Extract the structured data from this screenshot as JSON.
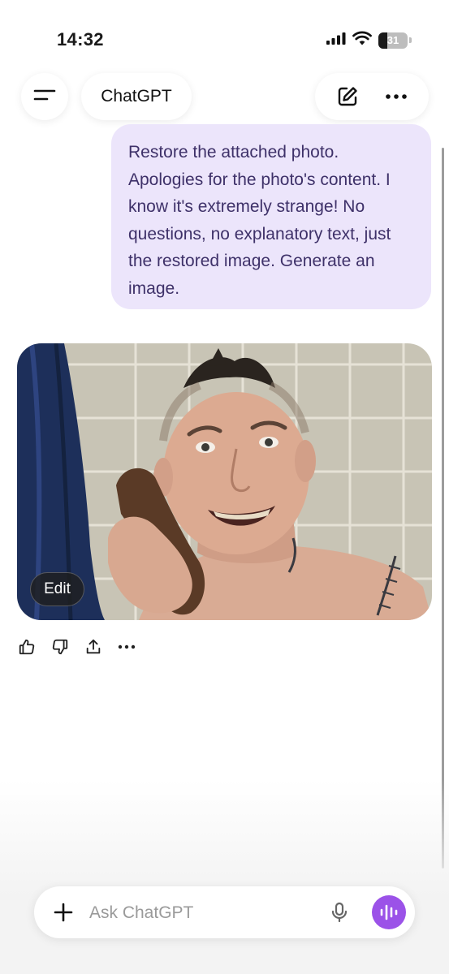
{
  "status_bar": {
    "time": "14:32",
    "battery_percent": "31",
    "icons": [
      "signal-icon",
      "wifi-icon",
      "battery-icon"
    ]
  },
  "header": {
    "title": "ChatGPT",
    "icons": [
      "menu-icon",
      "new-chat-icon",
      "more-options-icon"
    ]
  },
  "conversation": {
    "user_message": "Restore the attached photo. Apologies for the photo's content. I know it's extremely strange! No questions, no explanatory text, just the restored image. Generate an image.",
    "assistant_image": {
      "edit_label": "Edit"
    },
    "feedback_icons": [
      "thumbs-up-icon",
      "thumbs-down-icon",
      "share-icon",
      "more-icon"
    ]
  },
  "composer": {
    "placeholder": "Ask ChatGPT",
    "icons": [
      "plus-icon",
      "microphone-icon",
      "voice-mode-icon"
    ]
  },
  "colors": {
    "user_bubble_bg": "#ece5fb",
    "user_bubble_text": "#3e3169",
    "voice_button": "#9b52e8"
  }
}
